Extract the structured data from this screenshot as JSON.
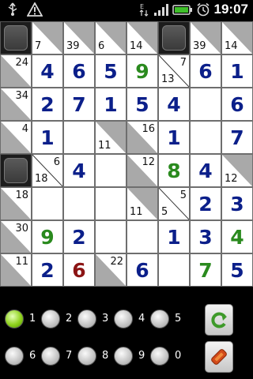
{
  "status_bar": {
    "time": "19:07",
    "icons": [
      "usb-icon",
      "warning-icon",
      "data-icon",
      "signal-icon",
      "battery-icon",
      "alarm-icon"
    ]
  },
  "board": {
    "rows": 8,
    "cols": 8,
    "grid": [
      [
        {
          "t": "b"
        },
        {
          "t": "c",
          "d": "7"
        },
        {
          "t": "c",
          "d": "39"
        },
        {
          "t": "c",
          "d": "6"
        },
        {
          "t": "c",
          "d": "14"
        },
        {
          "t": "b"
        },
        {
          "t": "c",
          "d": "39"
        },
        {
          "t": "c",
          "d": "14"
        }
      ],
      [
        {
          "t": "c",
          "r": "24"
        },
        {
          "t": "w",
          "v": "4",
          "col": "blue"
        },
        {
          "t": "w",
          "v": "6",
          "col": "blue"
        },
        {
          "t": "w",
          "v": "5",
          "col": "blue"
        },
        {
          "t": "w",
          "v": "9",
          "col": "green"
        },
        {
          "t": "c",
          "r": "7",
          "d": "13"
        },
        {
          "t": "w",
          "v": "6",
          "col": "blue"
        },
        {
          "t": "w",
          "v": "1",
          "col": "blue"
        }
      ],
      [
        {
          "t": "c",
          "r": "34"
        },
        {
          "t": "w",
          "v": "2",
          "col": "blue"
        },
        {
          "t": "w",
          "v": "7",
          "col": "blue"
        },
        {
          "t": "w",
          "v": "1",
          "col": "blue"
        },
        {
          "t": "w",
          "v": "5",
          "col": "blue"
        },
        {
          "t": "w",
          "v": "4",
          "col": "blue"
        },
        {
          "t": "w",
          "v": ""
        },
        {
          "t": "w",
          "v": "6",
          "col": "blue"
        }
      ],
      [
        {
          "t": "c",
          "r": "4"
        },
        {
          "t": "w",
          "v": "1",
          "col": "blue"
        },
        {
          "t": "w",
          "v": ""
        },
        {
          "t": "c",
          "d": "11"
        },
        {
          "t": "c",
          "r": "16"
        },
        {
          "t": "w",
          "v": "1",
          "col": "blue"
        },
        {
          "t": "w",
          "v": ""
        },
        {
          "t": "w",
          "v": "7",
          "col": "blue"
        }
      ],
      [
        {
          "t": "b"
        },
        {
          "t": "c",
          "r": "6",
          "d": "18"
        },
        {
          "t": "w",
          "v": "4",
          "col": "blue"
        },
        {
          "t": "w",
          "v": ""
        },
        {
          "t": "c",
          "r": "12"
        },
        {
          "t": "w",
          "v": "8",
          "col": "green"
        },
        {
          "t": "w",
          "v": "4",
          "col": "blue"
        },
        {
          "t": "c",
          "d": "12"
        }
      ],
      [
        {
          "t": "c",
          "r": "18"
        },
        {
          "t": "w",
          "v": ""
        },
        {
          "t": "w",
          "v": ""
        },
        {
          "t": "w",
          "v": ""
        },
        {
          "t": "c",
          "d": "11"
        },
        {
          "t": "c",
          "r": "5",
          "d": "5"
        },
        {
          "t": "w",
          "v": "2",
          "col": "blue"
        },
        {
          "t": "w",
          "v": "3",
          "col": "blue"
        }
      ],
      [
        {
          "t": "c",
          "r": "30"
        },
        {
          "t": "w",
          "v": "9",
          "col": "green"
        },
        {
          "t": "w",
          "v": "2",
          "col": "blue"
        },
        {
          "t": "w",
          "v": ""
        },
        {
          "t": "w",
          "v": ""
        },
        {
          "t": "w",
          "v": "1",
          "col": "blue"
        },
        {
          "t": "w",
          "v": "3",
          "col": "blue"
        },
        {
          "t": "w",
          "v": "4",
          "col": "green"
        }
      ],
      [
        {
          "t": "c",
          "r": "11"
        },
        {
          "t": "w",
          "v": "2",
          "col": "blue"
        },
        {
          "t": "w",
          "v": "6",
          "col": "red"
        },
        {
          "t": "c",
          "r": "22"
        },
        {
          "t": "w",
          "v": "6",
          "col": "blue"
        },
        {
          "t": "w",
          "v": ""
        },
        {
          "t": "w",
          "v": "7",
          "col": "green"
        },
        {
          "t": "w",
          "v": "5",
          "col": "blue"
        }
      ]
    ]
  },
  "colors": {
    "blue": "#0b1f8a",
    "green": "#2a8a1e",
    "red": "#8b1414",
    "clue_shade": "#a9a9a9",
    "radio_selected": "#8fd21d"
  },
  "number_picker": {
    "selected": "1",
    "options": [
      "1",
      "2",
      "3",
      "4",
      "5",
      "6",
      "7",
      "8",
      "9",
      "0"
    ]
  },
  "actions": {
    "undo_icon": "undo-arrow-icon",
    "clear_icon": "eraser-icon"
  }
}
